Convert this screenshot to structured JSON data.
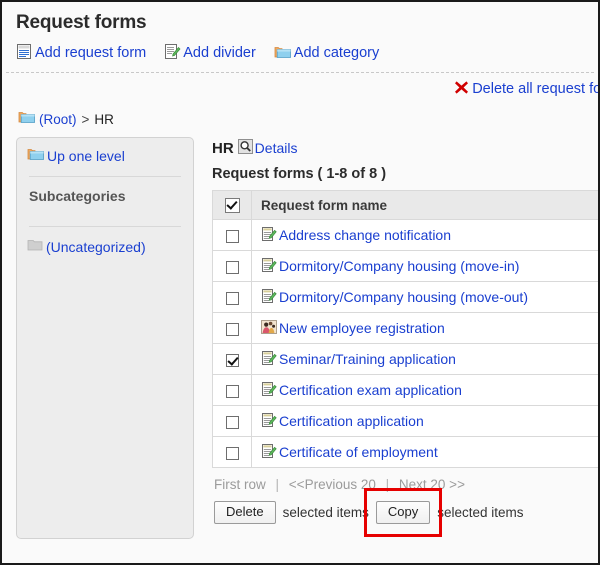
{
  "page": {
    "title": "Request forms"
  },
  "toolbar": {
    "items": [
      {
        "label": "Add request form",
        "icon": "request-form-icon"
      },
      {
        "label": "Add divider",
        "icon": "divider-icon"
      },
      {
        "label": "Add category",
        "icon": "folder-icon"
      }
    ],
    "delete_all": {
      "label": "Delete all request for",
      "icon": "delete-x-icon"
    }
  },
  "breadcrumb": {
    "icon": "folder-icon",
    "root_label": "(Root)",
    "separator": ">",
    "current_label": "HR"
  },
  "sidebar": {
    "up_one_level": {
      "label": "Up one level",
      "icon": "folder-up-icon"
    },
    "subcategories_heading": "Subcategories",
    "uncategorized": {
      "label": "(Uncategorized)",
      "icon": "folder-gray-icon"
    }
  },
  "main": {
    "category_name": "HR",
    "details_link": {
      "label": "Details",
      "icon": "magnifier-icon"
    },
    "count_line": "Request forms ( 1-8 of 8 )",
    "table": {
      "header_checkbox_checked": true,
      "columns": [
        "Request form name"
      ],
      "rows": [
        {
          "name": "Address change notification",
          "checked": false,
          "icon": "form-icon"
        },
        {
          "name": "Dormitory/Company housing (move-in)",
          "checked": false,
          "icon": "form-icon"
        },
        {
          "name": "Dormitory/Company housing (move-out)",
          "checked": false,
          "icon": "form-icon"
        },
        {
          "name": "New employee registration",
          "checked": false,
          "icon": "people-photo-icon"
        },
        {
          "name": "Seminar/Training application",
          "checked": true,
          "icon": "form-icon"
        },
        {
          "name": "Certification exam application",
          "checked": false,
          "icon": "form-icon"
        },
        {
          "name": "Certification application",
          "checked": false,
          "icon": "form-icon"
        },
        {
          "name": "Certificate of employment",
          "checked": false,
          "icon": "form-icon"
        }
      ]
    },
    "pager": {
      "first_row": "First row",
      "previous": "<<Previous 20",
      "next": "Next 20 >>",
      "bar": "|"
    },
    "actions": {
      "delete_button": "Delete",
      "delete_suffix": "selected items",
      "copy_button": "Copy",
      "copy_suffix": "selected items"
    }
  },
  "colors": {
    "link": "#1a3fd0",
    "highlight": "#e60000",
    "sidebar_bg": "#ededed",
    "table_header_bg": "#e9e9e9"
  }
}
